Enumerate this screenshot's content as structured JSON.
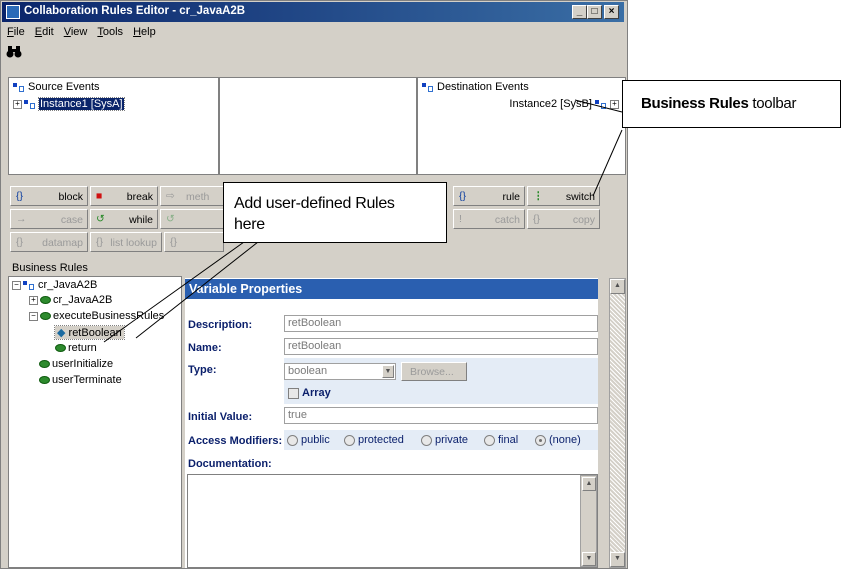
{
  "window": {
    "title": "Collaboration Rules Editor - cr_JavaA2B",
    "controls": [
      "_",
      "□",
      "×"
    ]
  },
  "menu": [
    "File",
    "Edit",
    "View",
    "Tools",
    "Help"
  ],
  "toolbar": {
    "find_icon": "binoculars-icon"
  },
  "source_events": {
    "header": "Source Events",
    "item": "Instance1 [SysA]"
  },
  "destination_events": {
    "header": "Destination Events",
    "item": "Instance2 [SysB]"
  },
  "rules_toolbar": {
    "row1": [
      {
        "icon": "{}",
        "label": "block"
      },
      {
        "icon": "■",
        "label": "break"
      },
      {
        "icon": "⇨",
        "label": "meth"
      },
      {
        "icon": "{}",
        "label": "rule"
      },
      {
        "icon": "⋮",
        "label": "switch"
      }
    ],
    "row2": [
      {
        "icon": "→",
        "label": "case"
      },
      {
        "icon": "↺",
        "label": "while"
      },
      {
        "icon": "↺",
        "label": ""
      },
      {
        "icon": "!",
        "label": "catch"
      },
      {
        "icon": "{}",
        "label": "copy"
      }
    ],
    "row3": [
      {
        "icon": "{}",
        "label": "datamap"
      },
      {
        "icon": "{}",
        "label": "list lookup"
      },
      {
        "icon": "{}",
        "label": ""
      }
    ]
  },
  "business_rules": {
    "header": "Business Rules",
    "tree": [
      "cr_JavaA2B",
      "cr_JavaA2B",
      "executeBusinessRules",
      "retBoolean",
      "return",
      "userInitialize",
      "userTerminate"
    ]
  },
  "variable_properties": {
    "title": "Variable Properties",
    "description_label": "Description:",
    "description": "retBoolean",
    "name_label": "Name:",
    "name": "retBoolean",
    "type_label": "Type:",
    "type": "boolean",
    "browse": "Browse...",
    "array": "Array",
    "initial_value_label": "Initial Value:",
    "initial_value": "true",
    "access_label": "Access Modifiers:",
    "access": [
      "public",
      "protected",
      "private",
      "final",
      "(none)"
    ],
    "documentation_label": "Documentation:"
  },
  "callouts": {
    "rules_bold": "Business Rules",
    "rules_rest": " toolbar",
    "add_line1": "Add user-defined Rules",
    "add_line2": "here"
  }
}
